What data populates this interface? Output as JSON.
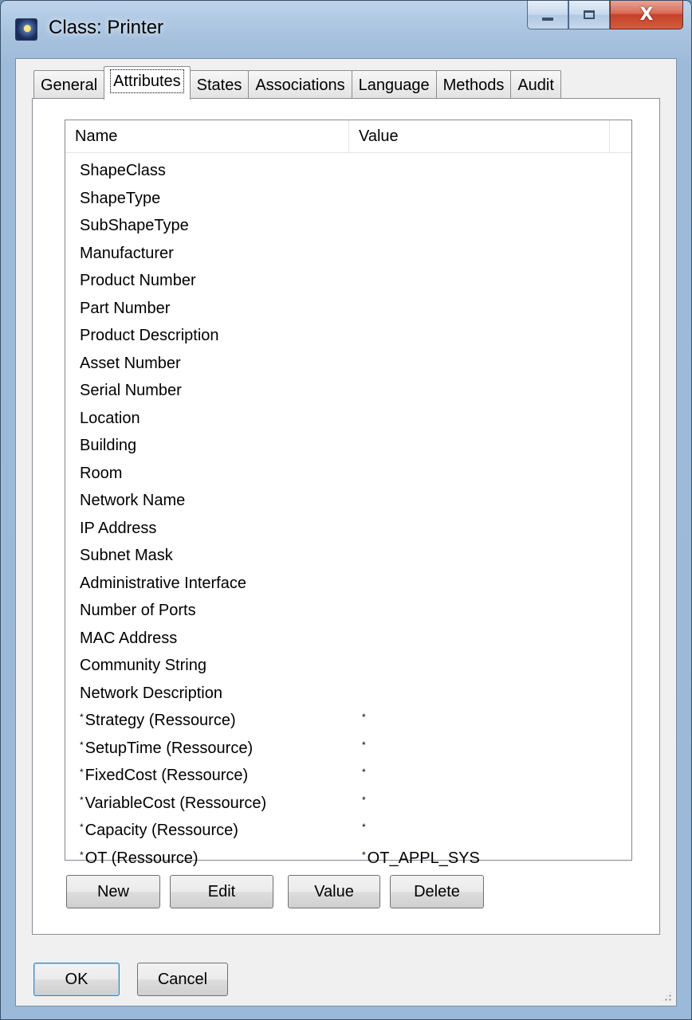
{
  "window": {
    "title": "Class: Printer",
    "close_glyph": "X"
  },
  "tabs": [
    {
      "label": "General",
      "active": false
    },
    {
      "label": "Attributes",
      "active": true
    },
    {
      "label": "States",
      "active": false
    },
    {
      "label": "Associations",
      "active": false
    },
    {
      "label": "Language",
      "active": false
    },
    {
      "label": "Methods",
      "active": false
    },
    {
      "label": "Audit",
      "active": false
    }
  ],
  "list": {
    "columns": {
      "name": "Name",
      "value": "Value"
    },
    "rows": [
      {
        "mark": "",
        "name": "ShapeClass",
        "value_mark": "",
        "value": ""
      },
      {
        "mark": "",
        "name": "ShapeType",
        "value_mark": "",
        "value": ""
      },
      {
        "mark": "",
        "name": "SubShapeType",
        "value_mark": "",
        "value": ""
      },
      {
        "mark": "",
        "name": "Manufacturer",
        "value_mark": "",
        "value": ""
      },
      {
        "mark": "",
        "name": "Product Number",
        "value_mark": "",
        "value": ""
      },
      {
        "mark": "",
        "name": "Part Number",
        "value_mark": "",
        "value": ""
      },
      {
        "mark": "",
        "name": "Product Description",
        "value_mark": "",
        "value": ""
      },
      {
        "mark": "",
        "name": "Asset Number",
        "value_mark": "",
        "value": ""
      },
      {
        "mark": "",
        "name": "Serial Number",
        "value_mark": "",
        "value": ""
      },
      {
        "mark": "",
        "name": "Location",
        "value_mark": "",
        "value": ""
      },
      {
        "mark": "",
        "name": "Building",
        "value_mark": "",
        "value": ""
      },
      {
        "mark": "",
        "name": "Room",
        "value_mark": "",
        "value": ""
      },
      {
        "mark": "",
        "name": "Network Name",
        "value_mark": "",
        "value": ""
      },
      {
        "mark": "",
        "name": "IP Address",
        "value_mark": "",
        "value": ""
      },
      {
        "mark": "",
        "name": "Subnet Mask",
        "value_mark": "",
        "value": ""
      },
      {
        "mark": "",
        "name": "Administrative Interface",
        "value_mark": "",
        "value": ""
      },
      {
        "mark": "",
        "name": "Number of Ports",
        "value_mark": "",
        "value": ""
      },
      {
        "mark": "",
        "name": "MAC Address",
        "value_mark": "",
        "value": ""
      },
      {
        "mark": "",
        "name": "Community String",
        "value_mark": "",
        "value": ""
      },
      {
        "mark": "",
        "name": "Network Description",
        "value_mark": "",
        "value": ""
      },
      {
        "mark": "*",
        "name": "Strategy (Ressource)",
        "value_mark": "*",
        "value": ""
      },
      {
        "mark": "*",
        "name": "SetupTime (Ressource)",
        "value_mark": "*",
        "value": ""
      },
      {
        "mark": "*",
        "name": "FixedCost (Ressource)",
        "value_mark": "*",
        "value": ""
      },
      {
        "mark": "*",
        "name": "VariableCost (Ressource)",
        "value_mark": "*",
        "value": ""
      },
      {
        "mark": "*",
        "name": "Capacity (Ressource)",
        "value_mark": "*",
        "value": ""
      },
      {
        "mark": "*",
        "name": "OT (Ressource)",
        "value_mark": "*",
        "value": "OT_APPL_SYS"
      }
    ]
  },
  "buttons": {
    "new": "New",
    "edit": "Edit",
    "value": "Value",
    "delete": "Delete",
    "ok": "OK",
    "cancel": "Cancel"
  }
}
